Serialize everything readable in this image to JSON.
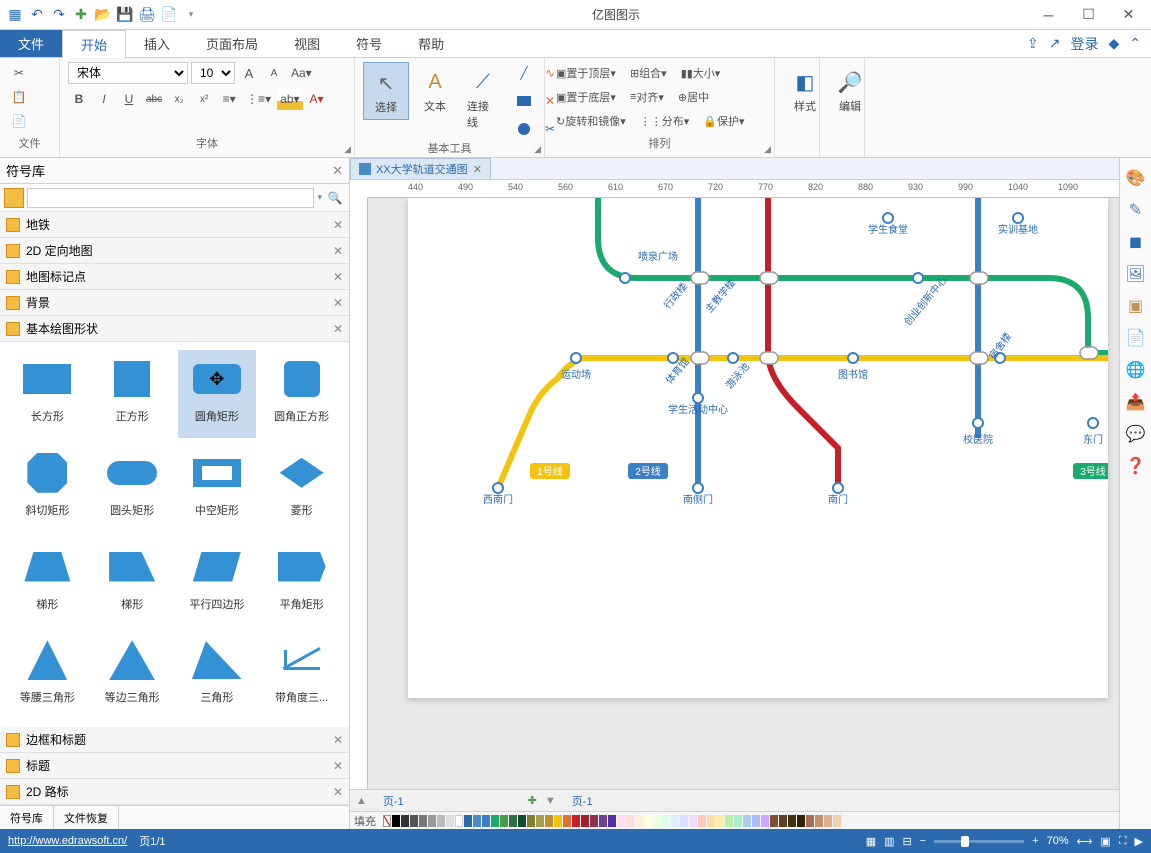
{
  "app_title": "亿图图示",
  "menu_tabs": {
    "file": "文件",
    "start": "开始",
    "insert": "插入",
    "layout": "页面布局",
    "view": "视图",
    "symbol": "符号",
    "help": "帮助"
  },
  "ribbon_right": {
    "login": "登录"
  },
  "ribbon": {
    "group_file": "文件",
    "group_font": "字体",
    "group_tools": "基本工具",
    "group_arrange": "排列",
    "group_style": "样式",
    "group_edit": "编辑",
    "font_name": "宋体",
    "font_size": "10",
    "bold": "B",
    "italic": "I",
    "underline": "U",
    "strike": "abc",
    "tool_select": "选择",
    "tool_text": "文本",
    "tool_connector": "连接线",
    "arr_top": "置于顶层",
    "arr_bottom": "置于底层",
    "arr_rotate": "旋转和镜像",
    "arr_group": "组合",
    "arr_align": "对齐",
    "arr_distribute": "分布",
    "arr_size": "大小",
    "arr_center": "居中",
    "arr_protect": "保护",
    "style": "样式",
    "edit": "编辑"
  },
  "panel": {
    "title": "符号库",
    "search_placeholder": ""
  },
  "categories": [
    "地铁",
    "2D 定向地图",
    "地图标记点",
    "背景",
    "基本绘图形状",
    "边框和标题",
    "标题",
    "2D 路标"
  ],
  "shapes": [
    "长方形",
    "正方形",
    "圆角矩形",
    "圆角正方形",
    "斜切矩形",
    "圆头矩形",
    "中空矩形",
    "菱形",
    "梯形",
    "梯形",
    "平行四边形",
    "平角矩形",
    "等腰三角形",
    "等边三角形",
    "三角形",
    "带角度三..."
  ],
  "panel_tabs": {
    "symbols": "符号库",
    "recovery": "文件恢复"
  },
  "doc_tab": "XX大学轨道交通图",
  "map": {
    "stations": {
      "s1": "学生食堂",
      "s2": "实训基地",
      "s3": "喷泉广场",
      "s4": "行政楼",
      "s5": "主教学楼",
      "s6": "创业创新中心",
      "s7": "运动场",
      "s8": "体育馆",
      "s9": "游泳池",
      "s10": "图书馆",
      "s11": "宿舍楼",
      "s12": "学生活动中心",
      "s13": "校医院",
      "s14": "东门",
      "s15": "西南门",
      "s16": "南侧门",
      "s17": "南门"
    },
    "lines": {
      "l1": "1号线",
      "l2": "2号线",
      "l3": "3号线"
    }
  },
  "ruler_marks": [
    "440",
    "490",
    "540",
    "560",
    "610",
    "670",
    "720",
    "770",
    "820",
    "880",
    "930",
    "990",
    "1040",
    "1090"
  ],
  "page_tabs": {
    "p1": "页-1",
    "p2": "页-1"
  },
  "colorbar_label": "填充",
  "status": {
    "url": "http://www.edrawsoft.cn/",
    "page": "页1/1",
    "zoom": "70%"
  }
}
